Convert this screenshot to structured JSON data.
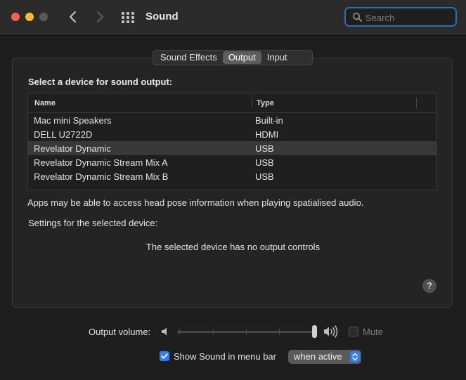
{
  "window": {
    "title": "Sound"
  },
  "search": {
    "placeholder": "Search",
    "value": ""
  },
  "tabs": [
    {
      "label": "Sound Effects",
      "active": false
    },
    {
      "label": "Output",
      "active": true
    },
    {
      "label": "Input",
      "active": false
    }
  ],
  "output": {
    "section_label": "Select a device for sound output:",
    "columns": [
      "Name",
      "Type"
    ],
    "devices": [
      {
        "name": "Mac mini Speakers",
        "type": "Built-in",
        "selected": false
      },
      {
        "name": "DELL U2722D",
        "type": "HDMI",
        "selected": false
      },
      {
        "name": "Revelator Dynamic",
        "type": "USB",
        "selected": true
      },
      {
        "name": "Revelator Dynamic Stream Mix A",
        "type": "USB",
        "selected": false
      },
      {
        "name": "Revelator Dynamic Stream Mix B",
        "type": "USB",
        "selected": false
      }
    ],
    "note": "Apps may be able to access head pose information when playing spatialised audio.",
    "settings_label": "Settings for the selected device:",
    "no_controls": "The selected device has no output controls",
    "help": "?"
  },
  "footer": {
    "volume_label": "Output volume:",
    "volume_level": 1.0,
    "mute_label": "Mute",
    "mute_checked": false,
    "menubar_label": "Show Sound in menu bar",
    "menubar_checked": true,
    "menubar_select_value": "when active"
  },
  "colors": {
    "accent": "#2f7ff6",
    "close": "#fe5f57",
    "minimize": "#febc2e",
    "focus_ring": "#2d6fb3"
  },
  "icons": [
    "back-chevron-icon",
    "forward-chevron-icon",
    "grid-icon",
    "search-icon",
    "speaker-low-icon",
    "speaker-high-icon",
    "checkmark-icon",
    "updown-arrows-icon"
  ]
}
